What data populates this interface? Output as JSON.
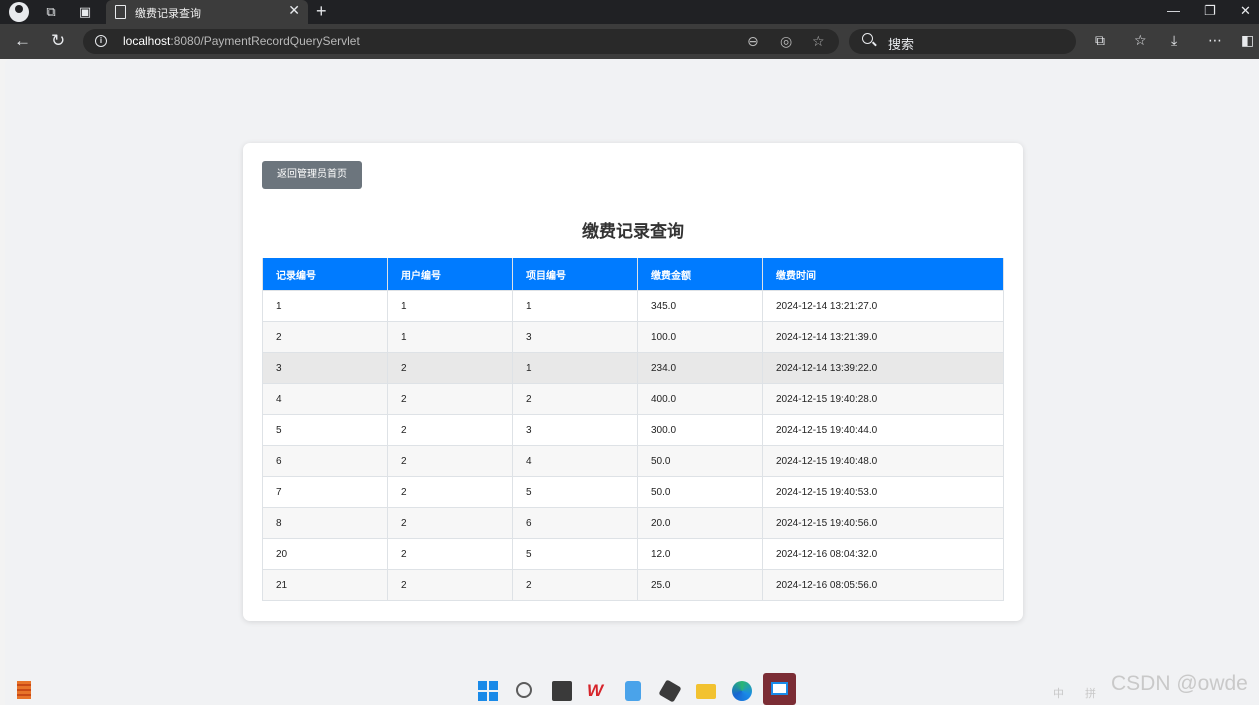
{
  "browser": {
    "tab_title": "缴费记录查询",
    "tab_close": "✕",
    "new_tab": "+",
    "url_host": "localhost",
    "url_rest": ":8080/PaymentRecordQueryServlet",
    "search_placeholder": "搜索"
  },
  "page": {
    "back_button": "返回管理员首页",
    "title": "缴费记录查询",
    "table": {
      "headers": [
        "记录编号",
        "用户编号",
        "项目编号",
        "缴费金额",
        "缴费时间"
      ],
      "rows": [
        [
          "1",
          "1",
          "1",
          "345.0",
          "2024-12-14 13:21:27.0"
        ],
        [
          "2",
          "1",
          "3",
          "100.0",
          "2024-12-14 13:21:39.0"
        ],
        [
          "3",
          "2",
          "1",
          "234.0",
          "2024-12-14 13:39:22.0"
        ],
        [
          "4",
          "2",
          "2",
          "400.0",
          "2024-12-15 19:40:28.0"
        ],
        [
          "5",
          "2",
          "3",
          "300.0",
          "2024-12-15 19:40:44.0"
        ],
        [
          "6",
          "2",
          "4",
          "50.0",
          "2024-12-15 19:40:48.0"
        ],
        [
          "7",
          "2",
          "5",
          "50.0",
          "2024-12-15 19:40:53.0"
        ],
        [
          "8",
          "2",
          "6",
          "20.0",
          "2024-12-15 19:40:56.0"
        ],
        [
          "20",
          "2",
          "5",
          "12.0",
          "2024-12-16 08:04:32.0"
        ],
        [
          "21",
          "2",
          "2",
          "25.0",
          "2024-12-16 08:05:56.0"
        ]
      ]
    }
  },
  "watermark": "CSDN @owde",
  "tray": {
    "ime": "中",
    "ime2": "拼"
  },
  "colors": {
    "header_bg": "#007bff",
    "back_button_bg": "#6c757d",
    "hover_row_bg": "#e8e8e8"
  }
}
